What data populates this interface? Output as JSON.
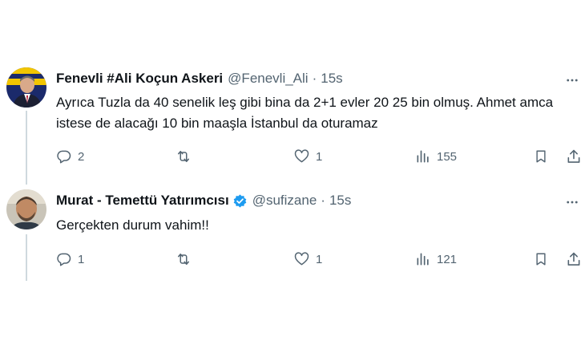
{
  "tweets": [
    {
      "author": "Fenevli #Ali Koçun Askeri",
      "handle": "@Fenevli_Ali",
      "separator": "·",
      "time": "15s",
      "verified": false,
      "text": "Ayrıca Tuzla da 40 senelik leş gibi bina da 2+1 evler 20 25 bin olmuş. Ahmet amca istese de alacağı 10 bin maaşla İstanbul da oturamaz",
      "replies": "2",
      "retweets": "",
      "likes": "1",
      "views": "155"
    },
    {
      "author": "Murat - Temettü Yatırımcısı",
      "handle": "@sufizane",
      "separator": "·",
      "time": "15s",
      "verified": true,
      "text": "Gerçekten durum vahim!!",
      "replies": "1",
      "retweets": "",
      "likes": "1",
      "views": "121"
    }
  ],
  "colors": {
    "text": "#0f1419",
    "secondary": "#536471",
    "verified": "#1d9bf0",
    "thread_line": "#cfd9de"
  },
  "icons": [
    "more-icon",
    "reply-icon",
    "retweet-icon",
    "like-icon",
    "views-icon",
    "bookmark-icon",
    "share-icon",
    "verified-badge-icon"
  ]
}
